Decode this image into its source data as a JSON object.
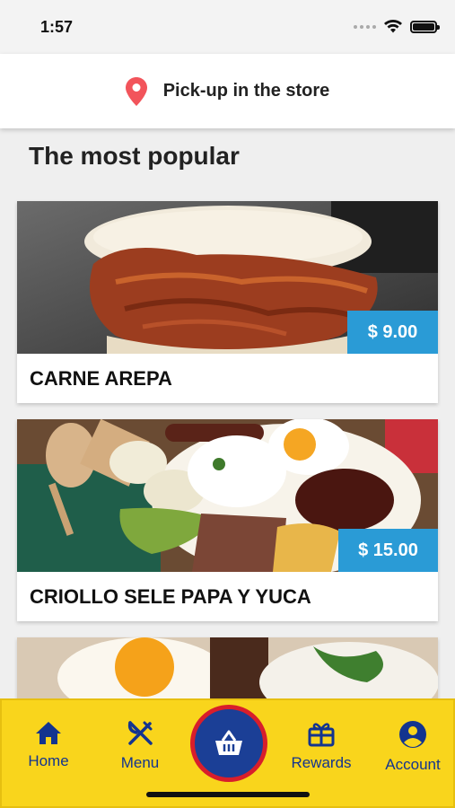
{
  "status": {
    "time": "1:57"
  },
  "pickup": {
    "label": "Pick-up in the store"
  },
  "section": {
    "title": "The most popular"
  },
  "products": [
    {
      "name": "CARNE AREPA",
      "price": "$ 9.00"
    },
    {
      "name": "CRIOLLO SELE PAPA Y YUCA",
      "price": "$ 15.00"
    }
  ],
  "tabs": {
    "home": "Home",
    "menu": "Menu",
    "rewards": "Rewards",
    "account": "Account"
  },
  "colors": {
    "accent_yellow": "#f9d51c",
    "brand_blue": "#13348f",
    "price_blue": "#2a9bd6",
    "basket_red": "#d81e2b",
    "pin_red": "#f2545b"
  },
  "icons": {
    "pickup": "location-pin-icon",
    "home": "home-icon",
    "menu": "fork-knife-icon",
    "basket": "basket-icon",
    "rewards": "gift-icon",
    "account": "account-icon"
  }
}
